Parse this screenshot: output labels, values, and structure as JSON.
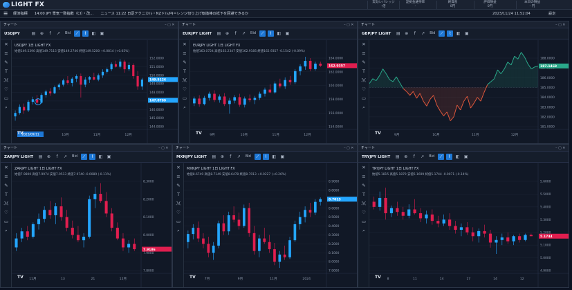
{
  "header": {
    "logo_text": "LIGHT FX",
    "stats": [
      {
        "label": "実効レバレッジ",
        "value": "-倍"
      },
      {
        "label": "証拠金維持率",
        "value": "-"
      },
      {
        "label": "純資産",
        "value": "0円"
      },
      {
        "label": "評価損益",
        "value": "0円"
      },
      {
        "label": "本日の損益",
        "value": "- 円"
      }
    ]
  },
  "menubar": {
    "items": [
      "経済指標",
      "14:00 JPY 景気一致指数（CI）・改…",
      "ニュース 11:22 日足テクニカル・NZドル/円＝レンジ切り上げ転換棒の抵下を回避できるか"
    ],
    "date": "2023/11/24 11:52:04",
    "settings": "設定"
  },
  "colors": {
    "up": "#24a6ff",
    "down": "#e01e4f",
    "line_up": "#2aa88a",
    "line_down": "#e0583c"
  },
  "toolbar_labels": {
    "bid": "Bid",
    "chart_type": "1日"
  },
  "panels": [
    {
      "id": "usdjpy",
      "title": "チャート",
      "symbol": "USDJPY",
      "info": "USDJPY 1日 LIGHT FX",
      "ohlc": "始値149.5390 高値149.7115 安値149.2740 終値149.5200 +0.0814 (+0.05%)",
      "price_tag": "149.5126",
      "price_tag2": "147.0799",
      "selected_date": "2023/09/11",
      "chart_data": {
        "type": "candlestick",
        "y_ticks": [
          "152.0000",
          "151.0000",
          "150.0000",
          "149.0000",
          "148.0000",
          "147.0000",
          "146.0000",
          "145.0000",
          "144.0000"
        ],
        "x_ticks": [
          "9月",
          "10月",
          "11月",
          "12月"
        ],
        "candles": [
          [
            145.2,
            145.9,
            144.7,
            145.6
          ],
          [
            145.6,
            146.6,
            145.4,
            146.3
          ],
          [
            146.3,
            146.7,
            145.5,
            145.9
          ],
          [
            145.9,
            147.1,
            145.7,
            146.9
          ],
          [
            146.9,
            147.5,
            146.6,
            147.2
          ],
          [
            147.2,
            147.7,
            146.5,
            146.8
          ],
          [
            146.8,
            147.9,
            146.7,
            147.7
          ],
          [
            147.7,
            148.3,
            147.4,
            148.1
          ],
          [
            148.1,
            148.5,
            147.6,
            147.9
          ],
          [
            147.9,
            148.8,
            147.8,
            148.6
          ],
          [
            148.6,
            149.1,
            148.3,
            148.9
          ],
          [
            148.9,
            149.6,
            148.7,
            149.4
          ],
          [
            149.4,
            149.9,
            148.9,
            149.1
          ],
          [
            149.1,
            149.8,
            148.7,
            149.6
          ],
          [
            149.6,
            150.1,
            149.2,
            149.9
          ],
          [
            149.9,
            150.2,
            147.4,
            148.9
          ],
          [
            148.9,
            149.8,
            148.6,
            149.5
          ],
          [
            149.5,
            149.9,
            149.1,
            149.8
          ],
          [
            149.8,
            150.3,
            149.4,
            149.5
          ],
          [
            149.5,
            150.2,
            149.3,
            150.0
          ],
          [
            150.0,
            150.7,
            149.7,
            150.4
          ],
          [
            150.4,
            150.9,
            150.2,
            150.7
          ],
          [
            150.7,
            151.5,
            150.5,
            151.3
          ],
          [
            151.3,
            151.7,
            150.9,
            151.0
          ],
          [
            151.0,
            151.9,
            150.8,
            151.6
          ],
          [
            151.6,
            151.8,
            150.3,
            150.7
          ],
          [
            150.7,
            151.5,
            150.5,
            151.2
          ],
          [
            151.2,
            151.4,
            149.6,
            149.9
          ],
          [
            149.9,
            150.5,
            148.3,
            148.7
          ],
          [
            148.7,
            149.7,
            148.3,
            149.5
          ]
        ]
      }
    },
    {
      "id": "eurjpy",
      "title": "チャート",
      "symbol": "EURJPY LIGHT",
      "info": "EURJPY LIGHT 1日 LIGHT FX",
      "ohlc": "始値163.0724 高値163.2347 安値162.9185 終値162.9357 -0.1542 (-0.09%)",
      "price_tag": "162.9357",
      "chart_data": {
        "type": "candlestick",
        "y_ticks": [
          "164.0000",
          "162.0000",
          "160.0000",
          "158.0000",
          "156.0000",
          "154.0000"
        ],
        "x_ticks": [
          "9月",
          "10月",
          "11月",
          "12月"
        ],
        "candles": [
          [
            157.4,
            158.4,
            157.0,
            158.1
          ],
          [
            158.1,
            158.6,
            156.9,
            157.3
          ],
          [
            157.3,
            158.5,
            157.1,
            158.2
          ],
          [
            158.2,
            159.1,
            157.8,
            158.8
          ],
          [
            158.8,
            159.3,
            157.6,
            157.9
          ],
          [
            157.9,
            158.7,
            157.5,
            158.4
          ],
          [
            158.4,
            158.9,
            157.0,
            157.3
          ],
          [
            157.3,
            158.2,
            155.9,
            157.8
          ],
          [
            157.8,
            158.6,
            157.4,
            158.3
          ],
          [
            158.3,
            158.8,
            156.9,
            157.2
          ],
          [
            157.2,
            158.4,
            156.8,
            158.1
          ],
          [
            158.1,
            158.7,
            157.6,
            157.9
          ],
          [
            157.9,
            158.5,
            157.3,
            158.2
          ],
          [
            158.2,
            159.1,
            157.9,
            158.8
          ],
          [
            158.8,
            159.7,
            158.4,
            159.4
          ],
          [
            159.4,
            160.2,
            158.9,
            159.0
          ],
          [
            159.0,
            160.6,
            158.8,
            160.3
          ],
          [
            160.3,
            161.0,
            159.6,
            159.9
          ],
          [
            159.9,
            161.2,
            159.5,
            160.8
          ],
          [
            160.8,
            161.4,
            160.1,
            160.5
          ],
          [
            160.5,
            162.4,
            160.2,
            162.1
          ],
          [
            162.1,
            163.1,
            161.5,
            162.8
          ],
          [
            162.8,
            164.2,
            162.3,
            163.6
          ],
          [
            163.6,
            164.0,
            162.1,
            162.4
          ],
          [
            162.4,
            163.5,
            162.2,
            163.2
          ],
          [
            163.2,
            163.5,
            162.7,
            162.9
          ]
        ]
      }
    },
    {
      "id": "gbpjpy",
      "title": "チャート",
      "symbol": "GBPJPY LIGHT",
      "price_tag": "187.1469",
      "chart_data": {
        "type": "area",
        "baseline": 185.0,
        "y_ticks": [
          "188.0000",
          "187.0000",
          "186.0000",
          "185.0000",
          "184.0000",
          "183.0000",
          "182.0000",
          "181.0000"
        ],
        "x_ticks": [
          "9月",
          "10月",
          "11月",
          "12月"
        ],
        "values": [
          185.4,
          185.9,
          185.7,
          186.2,
          186.9,
          186.4,
          185.8,
          185.6,
          186.1,
          185.5,
          184.9,
          184.6,
          184.2,
          184.6,
          183.9,
          184.4,
          183.6,
          183.1,
          183.8,
          184.2,
          183.2,
          182.6,
          182.1,
          182.5,
          181.6,
          182.0,
          183.2,
          182.7,
          183.6,
          184.1,
          182.9,
          183.4,
          184.0,
          183.6,
          184.5,
          185.3,
          185.6,
          185.9,
          186.8,
          186.4,
          186.9,
          187.6,
          187.3,
          188.2,
          187.9,
          188.6,
          188.1,
          187.4,
          186.9,
          187.1,
          187.2
        ]
      }
    },
    {
      "id": "zarjpy",
      "title": "チャート",
      "symbol": "ZARJPY LIGHT",
      "info": "ZARJPY LIGHT 1日 LIGHT FX",
      "ohlc": "始値7.9800 高値7.9974 安値7.9513 終値7.9740 -0.0089 (-0.11%)",
      "price_tag": "7.9186",
      "chart_data": {
        "type": "candlestick",
        "y_ticks": [
          "8.3000",
          "8.2000",
          "8.1000",
          "8.0000",
          "7.9000",
          "7.8000"
        ],
        "x_ticks": [
          "11月",
          "13",
          "21",
          "12月"
        ],
        "candles": [
          [
            7.93,
            8.01,
            7.91,
            7.98
          ],
          [
            7.98,
            8.04,
            7.96,
            8.02
          ],
          [
            8.02,
            8.05,
            7.97,
            7.99
          ],
          [
            7.99,
            8.07,
            7.98,
            8.06
          ],
          [
            8.06,
            8.12,
            8.03,
            8.09
          ],
          [
            8.09,
            8.16,
            8.07,
            8.14
          ],
          [
            8.14,
            8.19,
            8.09,
            8.11
          ],
          [
            8.11,
            8.18,
            8.06,
            8.16
          ],
          [
            8.16,
            8.21,
            8.08,
            8.1
          ],
          [
            8.1,
            8.14,
            8.02,
            8.04
          ],
          [
            8.04,
            8.08,
            7.98,
            8.0
          ],
          [
            8.0,
            8.05,
            7.96,
            7.97
          ],
          [
            7.97,
            8.01,
            7.93,
            7.99
          ],
          [
            7.99,
            8.22,
            7.98,
            8.2
          ],
          [
            8.2,
            8.27,
            8.15,
            8.23
          ],
          [
            8.23,
            8.29,
            8.18,
            8.19
          ],
          [
            8.19,
            8.24,
            8.1,
            8.12
          ],
          [
            8.12,
            8.15,
            8.02,
            8.04
          ],
          [
            8.04,
            8.07,
            7.97,
            7.98
          ],
          [
            7.98,
            8.01,
            7.91,
            7.93
          ],
          [
            7.93,
            7.97,
            7.9,
            7.95
          ],
          [
            7.95,
            7.98,
            7.91,
            7.92
          ]
        ]
      }
    },
    {
      "id": "mxnjpy",
      "title": "チャート",
      "symbol": "MXNJPY LIGHT",
      "info": "MXNJPY LIGHT 1日 LIGHT FX",
      "ohlc": "始値8.6749 高値8.7149 安値8.6478 終値8.7013 +0.0227 (+0.26%)",
      "price_tag": "8.7013",
      "chart_data": {
        "type": "candlestick",
        "y_ticks": [
          "8.9000",
          "8.8000",
          "8.7000",
          "8.6000",
          "8.5000",
          "8.4000",
          "8.3000",
          "8.2000",
          "8.1000",
          "8.0000",
          "7.9000"
        ],
        "x_ticks": [
          "7月",
          "9月",
          "11月",
          "2024"
        ],
        "candles": [
          [
            8.22,
            8.35,
            8.15,
            8.31
          ],
          [
            8.31,
            8.42,
            8.25,
            8.38
          ],
          [
            8.38,
            8.45,
            8.22,
            8.26
          ],
          [
            8.26,
            8.32,
            8.15,
            8.2
          ],
          [
            8.2,
            8.28,
            8.05,
            8.1
          ],
          [
            8.1,
            8.22,
            8.02,
            8.18
          ],
          [
            8.18,
            8.46,
            8.15,
            8.43
          ],
          [
            8.43,
            8.52,
            8.3,
            8.34
          ],
          [
            8.34,
            8.56,
            8.3,
            8.52
          ],
          [
            8.52,
            8.62,
            8.44,
            8.47
          ],
          [
            8.47,
            8.55,
            8.36,
            8.4
          ],
          [
            8.4,
            8.64,
            8.38,
            8.6
          ],
          [
            8.6,
            8.66,
            8.28,
            8.32
          ],
          [
            8.32,
            8.4,
            8.08,
            8.12
          ],
          [
            8.12,
            8.3,
            8.05,
            8.26
          ],
          [
            8.26,
            8.38,
            8.2,
            8.22
          ],
          [
            8.22,
            8.3,
            8.1,
            8.14
          ],
          [
            8.14,
            8.21,
            7.96,
            8.0
          ],
          [
            8.0,
            8.12,
            7.93,
            8.08
          ],
          [
            8.08,
            8.18,
            8.02,
            8.05
          ],
          [
            8.05,
            8.28,
            8.03,
            8.24
          ],
          [
            8.24,
            8.46,
            8.22,
            8.42
          ],
          [
            8.42,
            8.56,
            8.36,
            8.5
          ],
          [
            8.5,
            8.62,
            8.44,
            8.58
          ],
          [
            8.58,
            8.66,
            8.5,
            8.55
          ],
          [
            8.55,
            8.7,
            8.52,
            8.67
          ],
          [
            8.67,
            8.72,
            8.63,
            8.7
          ]
        ]
      }
    },
    {
      "id": "tryjpy",
      "title": "チャート",
      "symbol": "TRYJPY LIGHT",
      "info": "TRYJPY LIGHT 1日 LIGHT FX",
      "ohlc": "始値5.1815 高値5.1879 安値5.1699 終値5.1744 -0.0071 (-0.14%)",
      "price_tag": "5.1744",
      "chart_data": {
        "type": "candlestick",
        "y_ticks": [
          "5.6000",
          "5.5000",
          "5.4000",
          "5.3000",
          "5.2000",
          "5.1000",
          "5.0000",
          "4.9000"
        ],
        "x_ticks": [
          "8",
          "11",
          "14",
          "17",
          "14",
          "12"
        ],
        "candles": [
          [
            5.44,
            5.48,
            5.38,
            5.4
          ],
          [
            5.4,
            5.52,
            5.37,
            5.47
          ],
          [
            5.47,
            5.55,
            5.3,
            5.35
          ],
          [
            5.35,
            5.41,
            5.32,
            5.39
          ],
          [
            5.39,
            5.44,
            5.33,
            5.36
          ],
          [
            5.36,
            5.4,
            5.3,
            5.33
          ],
          [
            5.33,
            5.42,
            5.31,
            5.38
          ],
          [
            5.38,
            5.46,
            5.34,
            5.35
          ],
          [
            5.35,
            5.39,
            5.28,
            5.31
          ],
          [
            5.31,
            5.37,
            5.27,
            5.34
          ],
          [
            5.34,
            5.38,
            5.26,
            5.29
          ],
          [
            5.29,
            5.33,
            5.24,
            5.27
          ],
          [
            5.27,
            5.34,
            5.25,
            5.3
          ],
          [
            5.3,
            5.35,
            5.22,
            5.25
          ],
          [
            5.25,
            5.29,
            5.19,
            5.22
          ],
          [
            5.22,
            5.27,
            5.17,
            5.24
          ],
          [
            5.24,
            5.28,
            5.18,
            5.2
          ],
          [
            5.2,
            5.24,
            5.13,
            5.17
          ],
          [
            5.17,
            5.23,
            5.12,
            5.21
          ],
          [
            5.21,
            5.26,
            5.16,
            5.19
          ],
          [
            5.19,
            5.22,
            5.08,
            5.12
          ],
          [
            5.12,
            5.17,
            5.03,
            5.14
          ],
          [
            5.14,
            5.19,
            5.1,
            5.16
          ],
          [
            5.16,
            5.2,
            5.11,
            5.13
          ],
          [
            5.13,
            5.18,
            5.1,
            5.17
          ],
          [
            5.17,
            5.19,
            5.12,
            5.14
          ],
          [
            5.14,
            5.19,
            5.13,
            5.18
          ],
          [
            5.18,
            5.19,
            5.17,
            5.17
          ]
        ]
      }
    }
  ]
}
